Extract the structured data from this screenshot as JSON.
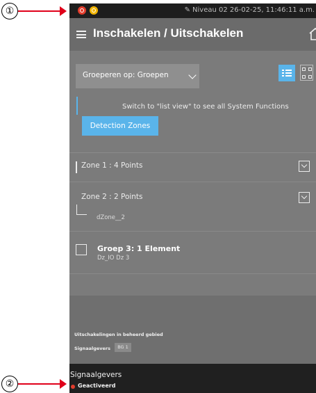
{
  "callouts": [
    "①",
    "②"
  ],
  "status_bar": {
    "icons": [
      "alarm-icon",
      "fault-icon"
    ],
    "info": "Niveau 02  26-02-25, 11:46:11 a.m."
  },
  "header": {
    "title": "Inschakelen / Uitschakelen",
    "icons": [
      "menu-icon",
      "home-icon"
    ]
  },
  "toolbar": {
    "group_by": "Groeperen op: Groepen",
    "icons": [
      "chevron-down-icon",
      "list-view-icon",
      "tree-view-icon"
    ]
  },
  "info": {
    "message": "Switch to \"list view\" to see all System Functions",
    "button": "Detection Zones"
  },
  "zones": [
    {
      "label": "Zone 1 : 4 Points"
    },
    {
      "label": "Zone 2 : 2 Points",
      "child": "dZone__2"
    }
  ],
  "group": {
    "title": "Groep 3: 1 Element",
    "subtitle": "Dz_IO Dz 3"
  },
  "bottom_list": {
    "title": "Uitschakelingen in beheerd gebied",
    "row_label": "Signaalgevers",
    "row_badge": "BG 1"
  },
  "footer": {
    "name": "Signaalgevers",
    "state": "Geactiveerd"
  },
  "colors": {
    "accent": "#5ab4ea",
    "alarm": "#e23c2c",
    "fault": "#f2b400"
  }
}
